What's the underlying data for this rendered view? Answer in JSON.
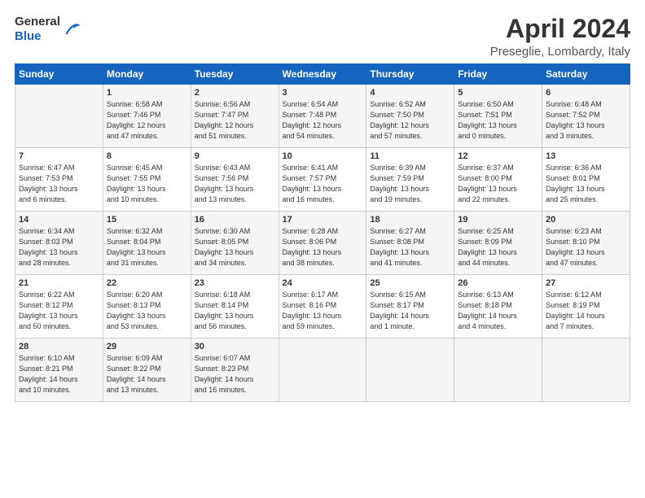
{
  "header": {
    "logo_general": "General",
    "logo_blue": "Blue",
    "month_title": "April 2024",
    "location": "Preseglie, Lombardy, Italy"
  },
  "columns": [
    "Sunday",
    "Monday",
    "Tuesday",
    "Wednesday",
    "Thursday",
    "Friday",
    "Saturday"
  ],
  "weeks": [
    [
      {
        "day": "",
        "info": ""
      },
      {
        "day": "1",
        "info": "Sunrise: 6:58 AM\nSunset: 7:46 PM\nDaylight: 12 hours\nand 47 minutes."
      },
      {
        "day": "2",
        "info": "Sunrise: 6:56 AM\nSunset: 7:47 PM\nDaylight: 12 hours\nand 51 minutes."
      },
      {
        "day": "3",
        "info": "Sunrise: 6:54 AM\nSunset: 7:48 PM\nDaylight: 12 hours\nand 54 minutes."
      },
      {
        "day": "4",
        "info": "Sunrise: 6:52 AM\nSunset: 7:50 PM\nDaylight: 12 hours\nand 57 minutes."
      },
      {
        "day": "5",
        "info": "Sunrise: 6:50 AM\nSunset: 7:51 PM\nDaylight: 13 hours\nand 0 minutes."
      },
      {
        "day": "6",
        "info": "Sunrise: 6:48 AM\nSunset: 7:52 PM\nDaylight: 13 hours\nand 3 minutes."
      }
    ],
    [
      {
        "day": "7",
        "info": "Sunrise: 6:47 AM\nSunset: 7:53 PM\nDaylight: 13 hours\nand 6 minutes."
      },
      {
        "day": "8",
        "info": "Sunrise: 6:45 AM\nSunset: 7:55 PM\nDaylight: 13 hours\nand 10 minutes."
      },
      {
        "day": "9",
        "info": "Sunrise: 6:43 AM\nSunset: 7:56 PM\nDaylight: 13 hours\nand 13 minutes."
      },
      {
        "day": "10",
        "info": "Sunrise: 6:41 AM\nSunset: 7:57 PM\nDaylight: 13 hours\nand 16 minutes."
      },
      {
        "day": "11",
        "info": "Sunrise: 6:39 AM\nSunset: 7:59 PM\nDaylight: 13 hours\nand 19 minutes."
      },
      {
        "day": "12",
        "info": "Sunrise: 6:37 AM\nSunset: 8:00 PM\nDaylight: 13 hours\nand 22 minutes."
      },
      {
        "day": "13",
        "info": "Sunrise: 6:36 AM\nSunset: 8:01 PM\nDaylight: 13 hours\nand 25 minutes."
      }
    ],
    [
      {
        "day": "14",
        "info": "Sunrise: 6:34 AM\nSunset: 8:03 PM\nDaylight: 13 hours\nand 28 minutes."
      },
      {
        "day": "15",
        "info": "Sunrise: 6:32 AM\nSunset: 8:04 PM\nDaylight: 13 hours\nand 31 minutes."
      },
      {
        "day": "16",
        "info": "Sunrise: 6:30 AM\nSunset: 8:05 PM\nDaylight: 13 hours\nand 34 minutes."
      },
      {
        "day": "17",
        "info": "Sunrise: 6:28 AM\nSunset: 8:06 PM\nDaylight: 13 hours\nand 38 minutes."
      },
      {
        "day": "18",
        "info": "Sunrise: 6:27 AM\nSunset: 8:08 PM\nDaylight: 13 hours\nand 41 minutes."
      },
      {
        "day": "19",
        "info": "Sunrise: 6:25 AM\nSunset: 8:09 PM\nDaylight: 13 hours\nand 44 minutes."
      },
      {
        "day": "20",
        "info": "Sunrise: 6:23 AM\nSunset: 8:10 PM\nDaylight: 13 hours\nand 47 minutes."
      }
    ],
    [
      {
        "day": "21",
        "info": "Sunrise: 6:22 AM\nSunset: 8:12 PM\nDaylight: 13 hours\nand 50 minutes."
      },
      {
        "day": "22",
        "info": "Sunrise: 6:20 AM\nSunset: 8:13 PM\nDaylight: 13 hours\nand 53 minutes."
      },
      {
        "day": "23",
        "info": "Sunrise: 6:18 AM\nSunset: 8:14 PM\nDaylight: 13 hours\nand 56 minutes."
      },
      {
        "day": "24",
        "info": "Sunrise: 6:17 AM\nSunset: 8:16 PM\nDaylight: 13 hours\nand 59 minutes."
      },
      {
        "day": "25",
        "info": "Sunrise: 6:15 AM\nSunset: 8:17 PM\nDaylight: 14 hours\nand 1 minute."
      },
      {
        "day": "26",
        "info": "Sunrise: 6:13 AM\nSunset: 8:18 PM\nDaylight: 14 hours\nand 4 minutes."
      },
      {
        "day": "27",
        "info": "Sunrise: 6:12 AM\nSunset: 8:19 PM\nDaylight: 14 hours\nand 7 minutes."
      }
    ],
    [
      {
        "day": "28",
        "info": "Sunrise: 6:10 AM\nSunset: 8:21 PM\nDaylight: 14 hours\nand 10 minutes."
      },
      {
        "day": "29",
        "info": "Sunrise: 6:09 AM\nSunset: 8:22 PM\nDaylight: 14 hours\nand 13 minutes."
      },
      {
        "day": "30",
        "info": "Sunrise: 6:07 AM\nSunset: 8:23 PM\nDaylight: 14 hours\nand 16 minutes."
      },
      {
        "day": "",
        "info": ""
      },
      {
        "day": "",
        "info": ""
      },
      {
        "day": "",
        "info": ""
      },
      {
        "day": "",
        "info": ""
      }
    ]
  ]
}
